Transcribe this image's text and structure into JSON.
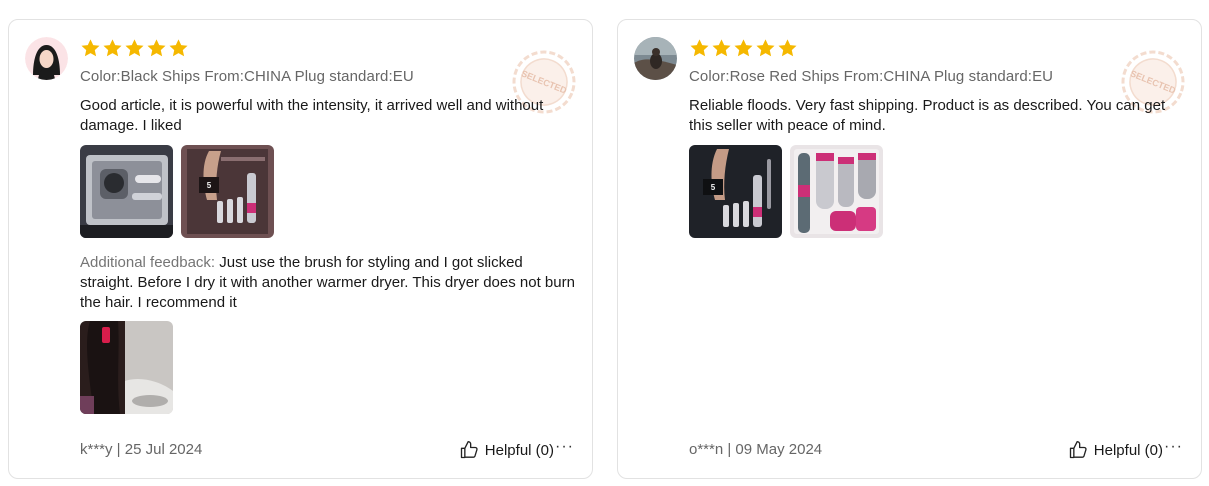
{
  "colors": {
    "star": "#f5b800",
    "muted": "#666666",
    "border": "#e2e2e2"
  },
  "reviews": [
    {
      "rating": 5,
      "sku": "Color:Black Ships From:CHINA Plug standard:EU",
      "text": "Good article, it is powerful with the intensity, it arrived well and without damage. I liked",
      "stamp": "SELECTED",
      "additional_label": "Additional feedback:",
      "additional_text": " Just use the brush for styling and I got slicked straight. Before I dry it with another warmer dryer. This dryer does not burn the hair. I recommend it",
      "user": "k***y | 25 Jul 2024",
      "helpful": "Helpful (0)",
      "more": "···"
    },
    {
      "rating": 5,
      "sku": "Color:Rose Red Ships From:CHINA Plug standard:EU",
      "text": "Reliable floods. Very fast shipping. Product is as described. You can get this seller with peace of mind.",
      "stamp": "SELECTED",
      "user": "o***n | 09 May 2024",
      "helpful": "Helpful (0)",
      "more": "···"
    }
  ]
}
